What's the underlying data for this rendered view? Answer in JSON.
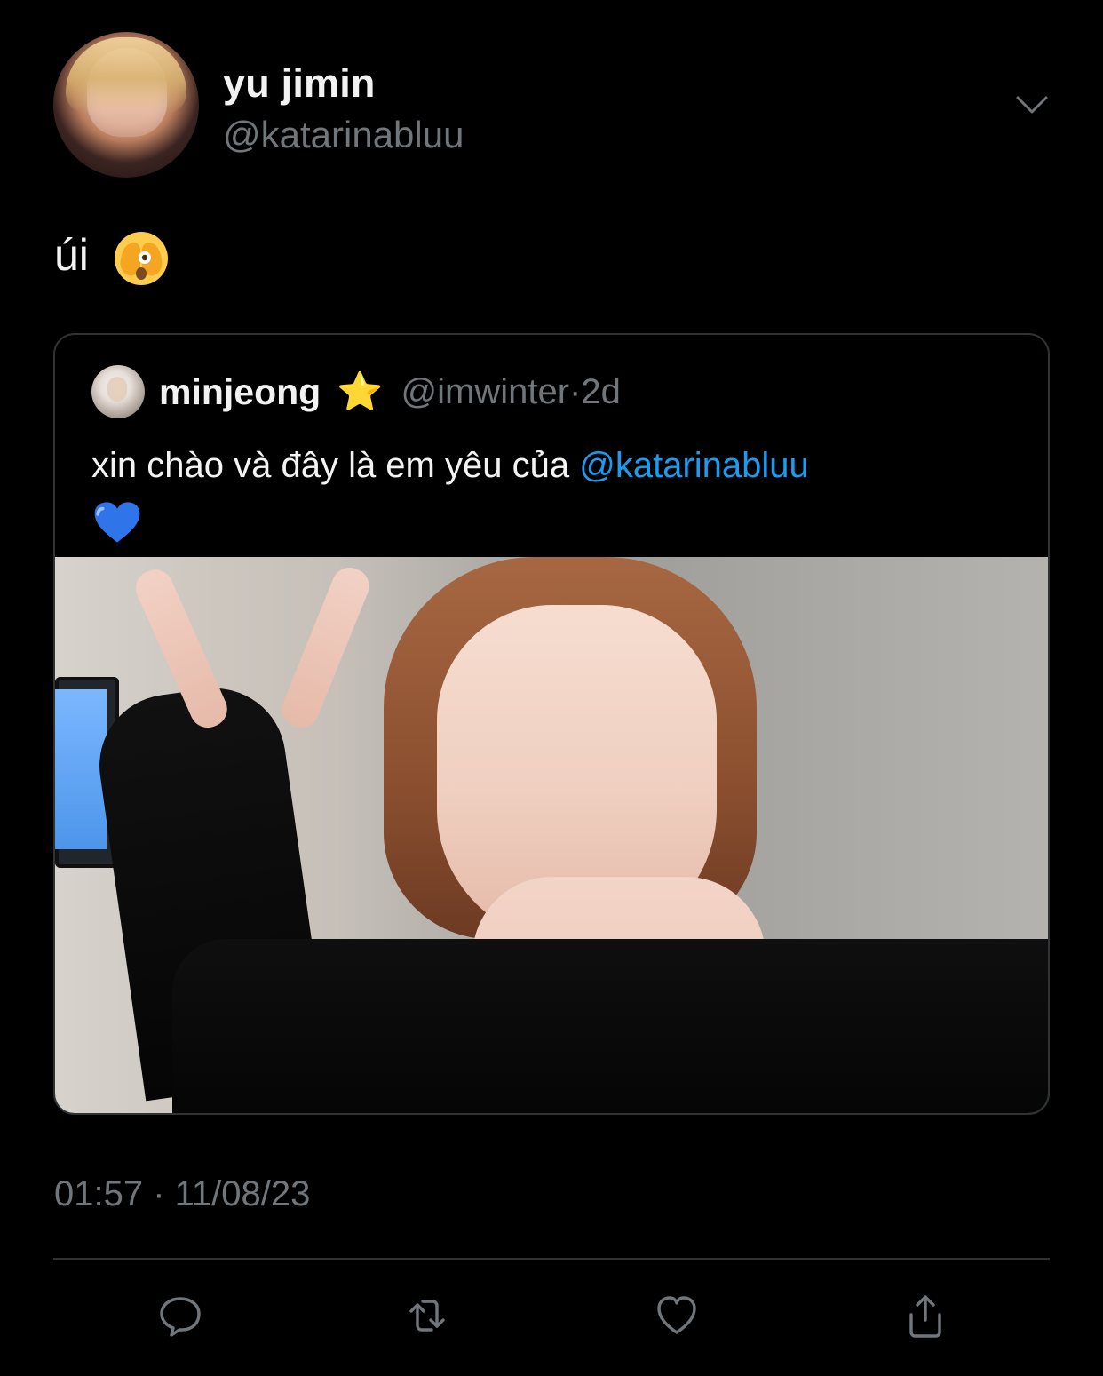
{
  "tweet": {
    "author": {
      "display_name": "yu jimin",
      "handle": "@katarinabluu"
    },
    "text": "úi",
    "timestamp": "01:57 · 11/08/23",
    "menu_icon": "chevron-down-icon"
  },
  "quoted_tweet": {
    "author": {
      "display_name": "minjeong",
      "badge": "⭐",
      "handle": "@imwinter",
      "separator": "·",
      "age": "2d"
    },
    "text_prefix": "xin chào và đây là em yêu của",
    "mention": "@katarinabluu"
  },
  "actions": [
    {
      "name": "reply-button",
      "icon": "comment-icon"
    },
    {
      "name": "retweet-button",
      "icon": "retweet-icon"
    },
    {
      "name": "like-button",
      "icon": "heart-icon"
    },
    {
      "name": "share-button",
      "icon": "share-icon"
    }
  ],
  "colors": {
    "background": "#000000",
    "primary_text": "#e7e9ea",
    "secondary_text": "#71767b",
    "mention": "#1d9bf0",
    "border": "#2f3336"
  }
}
